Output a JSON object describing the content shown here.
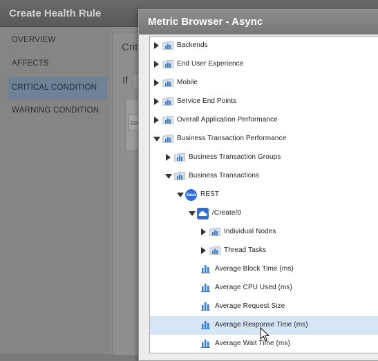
{
  "background": {
    "title": "Create Health Rule",
    "nav": [
      "OVERVIEW",
      "AFFECTS",
      "CRITICAL CONDITION",
      "WARNING CONDITION"
    ],
    "selected_nav": "CRITICAL CONDITION",
    "section_label": "Crit",
    "if_label": "If",
    "cond_input": "co"
  },
  "metric_browser": {
    "title": "Metric Browser - Async",
    "tree": [
      {
        "label": "Backends",
        "depth": 0,
        "expander": "collapsed",
        "icon": "folder-chart-icon"
      },
      {
        "label": "End User Experience",
        "depth": 0,
        "expander": "collapsed",
        "icon": "folder-chart-icon"
      },
      {
        "label": "Mobile",
        "depth": 0,
        "expander": "collapsed",
        "icon": "folder-chart-icon"
      },
      {
        "label": "Service End Points",
        "depth": 0,
        "expander": "collapsed",
        "icon": "folder-chart-icon"
      },
      {
        "label": "Overall Application Performance",
        "depth": 0,
        "expander": "collapsed",
        "icon": "folder-chart-icon"
      },
      {
        "label": "Business Transaction Performance",
        "depth": 0,
        "expander": "expanded",
        "icon": "folder-chart-icon"
      },
      {
        "label": "Business Transaction Groups",
        "depth": 1,
        "expander": "collapsed",
        "icon": "folder-chart-icon"
      },
      {
        "label": "Business Transactions",
        "depth": 1,
        "expander": "expanded",
        "icon": "folder-chart-icon"
      },
      {
        "label": "REST",
        "depth": 2,
        "expander": "expanded",
        "icon": "java-icon",
        "icon_text": "Java"
      },
      {
        "label": "/Create/0",
        "depth": 3,
        "expander": "expanded",
        "icon": "cloud-icon"
      },
      {
        "label": "Individual Nodes",
        "depth": 4,
        "expander": "collapsed",
        "icon": "folder-chart-icon"
      },
      {
        "label": "Thread Tasks",
        "depth": 4,
        "expander": "collapsed",
        "icon": "folder-chart-icon"
      },
      {
        "label": "Average Block Time (ms)",
        "depth": 4,
        "expander": "none",
        "icon": "bar-chart-icon"
      },
      {
        "label": "Average CPU Used (ms)",
        "depth": 4,
        "expander": "none",
        "icon": "bar-chart-icon"
      },
      {
        "label": "Average Request Size",
        "depth": 4,
        "expander": "none",
        "icon": "bar-chart-icon"
      },
      {
        "label": "Average Response Time (ms)",
        "depth": 4,
        "expander": "none",
        "icon": "bar-chart-icon",
        "selected": true
      },
      {
        "label": "Average Wait Time (ms)",
        "depth": 4,
        "expander": "none",
        "icon": "bar-chart-icon"
      }
    ]
  },
  "colors": {
    "accent": "#2f6fd6",
    "selection": "#d6e6f7",
    "icon_blue": "#3a78c8"
  }
}
